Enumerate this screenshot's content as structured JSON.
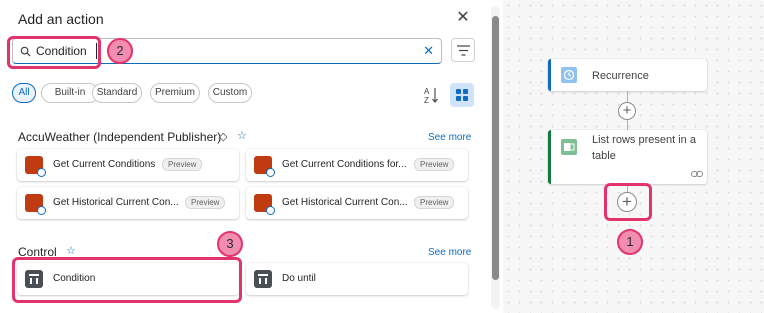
{
  "panel": {
    "title": "Add an action",
    "close_icon": "close-icon",
    "search": {
      "value": "Condition",
      "placeholder": ""
    },
    "filter_chips": [
      "All",
      "Built-in",
      "Standard",
      "Premium",
      "Custom"
    ],
    "active_chip": "All"
  },
  "sections": [
    {
      "title": "AccuWeather (Independent Publisher)",
      "see_more": "See more",
      "items": [
        {
          "label": "Get Current Conditions",
          "badge": "Preview"
        },
        {
          "label": "Get Current Conditions for...",
          "badge": "Preview"
        },
        {
          "label": "Get Historical Current Con...",
          "badge": "Preview"
        },
        {
          "label": "Get Historical Current Con...",
          "badge": "Preview"
        }
      ]
    },
    {
      "title": "Control",
      "see_more": "See more",
      "items": [
        {
          "label": "Condition"
        },
        {
          "label": "Do until"
        }
      ]
    }
  ],
  "canvas": {
    "nodes": [
      {
        "label": "Recurrence",
        "icon": "clock-icon",
        "accent": "#0f6cbd"
      },
      {
        "label": "List rows present in a table",
        "label_line1": "List rows present in a",
        "label_line2": "table",
        "icon": "excel-icon",
        "accent": "#107c41"
      }
    ]
  },
  "annotations": [
    "1",
    "2",
    "3"
  ],
  "colors": {
    "highlight": "#e2336b",
    "brand": "#0f6cbd",
    "badge_fill": "#f08db0"
  }
}
